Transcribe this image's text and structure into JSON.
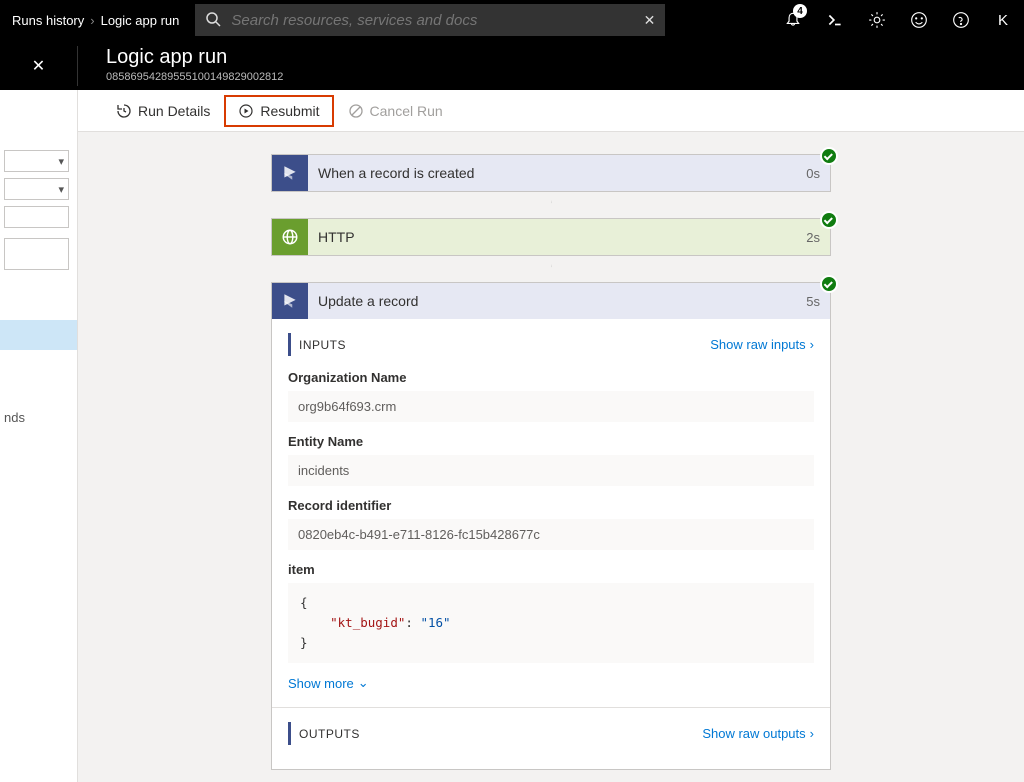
{
  "top": {
    "breadcrumb": [
      "Runs history",
      "Logic app run"
    ],
    "search_placeholder": "Search resources, services and docs",
    "notif_count": "4"
  },
  "header": {
    "title": "Logic app run",
    "run_id": "08586954289555100149829002812"
  },
  "toolbar": {
    "run_details": "Run Details",
    "resubmit": "Resubmit",
    "cancel": "Cancel Run"
  },
  "left": {
    "nds": "nds"
  },
  "flow": {
    "trigger": {
      "label": "When a record is created",
      "time": "0s"
    },
    "http": {
      "label": "HTTP",
      "time": "2s"
    },
    "update": {
      "label": "Update a record",
      "time": "5s"
    }
  },
  "inputs": {
    "section": "INPUTS",
    "raw_link": "Show raw inputs",
    "fields": {
      "org_label": "Organization Name",
      "org_value": "org9b64f693.crm",
      "entity_label": "Entity Name",
      "entity_value": "incidents",
      "recid_label": "Record identifier",
      "recid_value": "0820eb4c-b491-e711-8126-fc15b428677c",
      "item_label": "item",
      "item_key": "kt_bugid",
      "item_val": "16"
    },
    "show_more": "Show more"
  },
  "outputs": {
    "section": "OUTPUTS",
    "raw_link": "Show raw outputs"
  }
}
